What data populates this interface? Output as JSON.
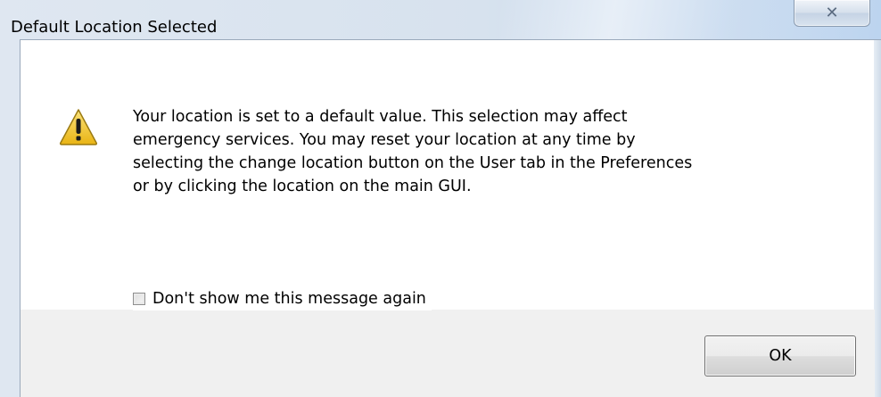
{
  "window": {
    "title": "Default Location Selected",
    "close_icon": "close-icon",
    "close_glyph": "✕"
  },
  "message": {
    "icon": "warning-icon",
    "lines": [
      "Your location is set to a default value. This selection may affect",
      "emergency services. You may reset your location at any time by",
      "selecting the change location button on the User tab in the Preferences",
      "or by clicking the location on the main GUI."
    ]
  },
  "checkbox": {
    "label": "Don't show me this message again",
    "checked": false
  },
  "buttons": {
    "ok_label": "OK"
  },
  "colors": {
    "warning_fill": "#f3c623",
    "warning_stroke": "#9a7a12",
    "footer_bg": "#f0f0f0"
  }
}
